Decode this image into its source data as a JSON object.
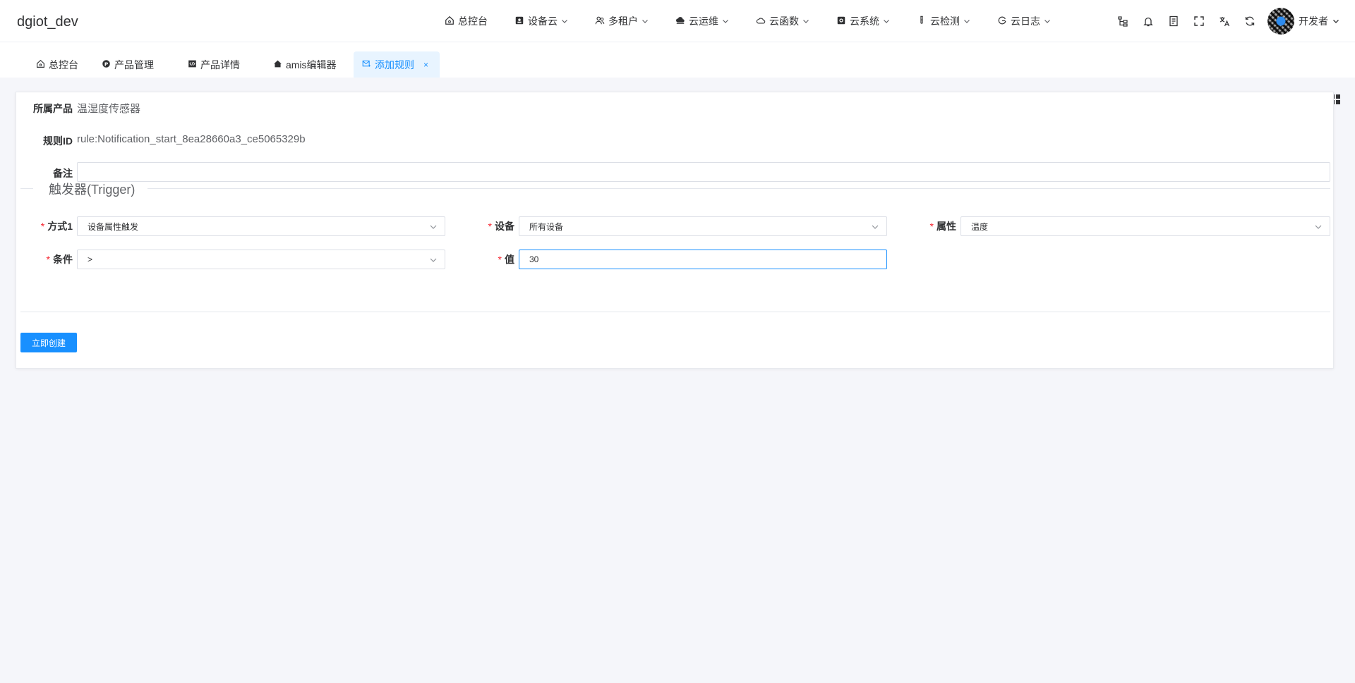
{
  "app": {
    "title": "dgiot_dev"
  },
  "topnav": {
    "items": [
      {
        "label": "总控台",
        "icon": "home-icon",
        "has_dropdown": false
      },
      {
        "label": "设备云",
        "icon": "device-icon",
        "has_dropdown": true
      },
      {
        "label": "多租户",
        "icon": "users-icon",
        "has_dropdown": true
      },
      {
        "label": "云运维",
        "icon": "cloud-ops-icon",
        "has_dropdown": true
      },
      {
        "label": "云函数",
        "icon": "cloud-function-icon",
        "has_dropdown": true
      },
      {
        "label": "云系统",
        "icon": "cloud-system-icon",
        "has_dropdown": true
      },
      {
        "label": "云检测",
        "icon": "test-tube-icon",
        "has_dropdown": true
      },
      {
        "label": "云日志",
        "icon": "log-icon",
        "has_dropdown": true
      }
    ],
    "tools": [
      "sitemap-icon",
      "bell-icon",
      "document-icon",
      "fullscreen-icon",
      "translate-icon",
      "refresh-icon"
    ],
    "user": {
      "name": "开发者"
    }
  },
  "tabs": [
    {
      "label": "总控台",
      "icon": "home-icon",
      "active": false
    },
    {
      "label": "产品管理",
      "icon": "product-icon",
      "active": false
    },
    {
      "label": "产品详情",
      "icon": "code-icon",
      "active": false
    },
    {
      "label": "amis编辑器",
      "icon": "editor-icon",
      "active": false
    },
    {
      "label": "添加规则",
      "icon": "mail-icon",
      "active": true,
      "closable": true,
      "close_label": "×"
    }
  ],
  "form": {
    "product": {
      "label": "所属产品",
      "value": "温湿度传感器"
    },
    "rule_id": {
      "label": "规则ID",
      "value": "rule:Notification_start_8ea28660a3_ce5065329b"
    },
    "remark": {
      "label": "备注",
      "value": ""
    },
    "trigger_section": {
      "title": "触发器(Trigger)"
    },
    "required_mark": "*",
    "method": {
      "label": "方式1",
      "value": "设备属性触发"
    },
    "device": {
      "label": "设备",
      "value": "所有设备"
    },
    "attribute": {
      "label": "属性",
      "value": "温度"
    },
    "condition": {
      "label": "条件",
      "value": ">"
    },
    "value": {
      "label": "值",
      "value": "30"
    },
    "submit_label": "立即创建"
  },
  "colors": {
    "accent": "#1890ff",
    "required": "#f5222d",
    "active_tab_bg": "#e8f4ff",
    "page_bg": "#f5f6fa"
  }
}
